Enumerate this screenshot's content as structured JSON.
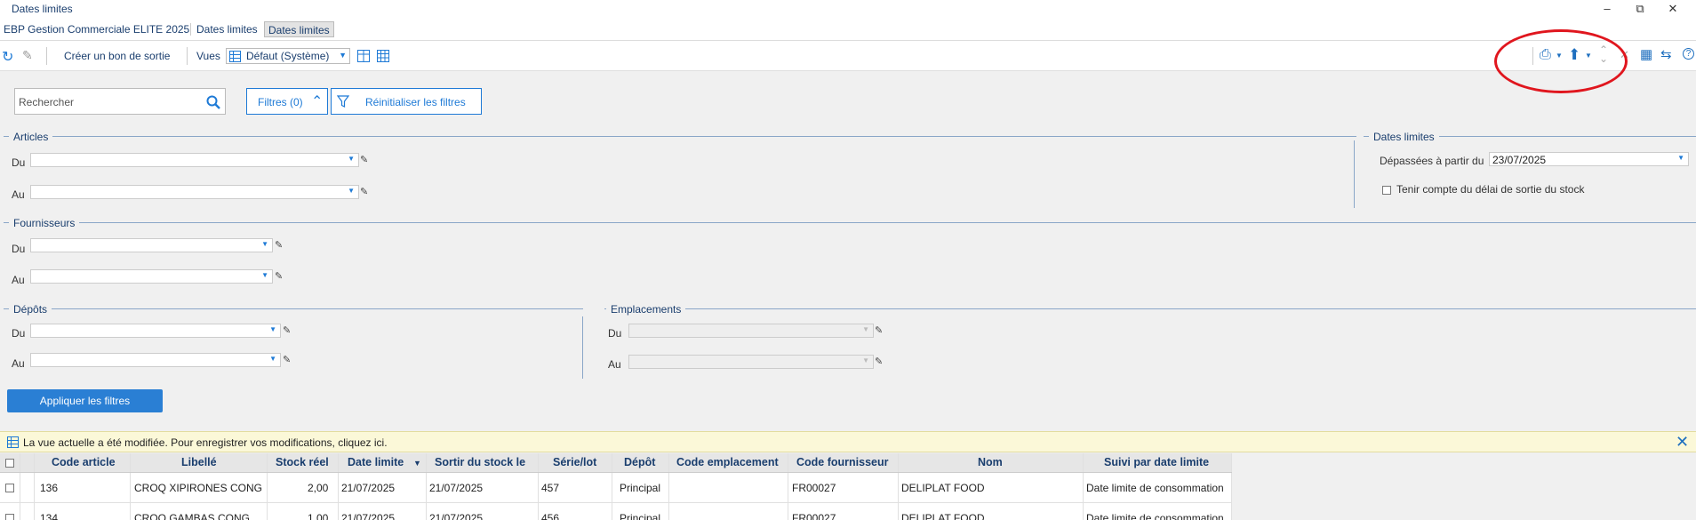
{
  "window": {
    "title": "Dates limites"
  },
  "tabs": [
    "EBP Gestion Commerciale ELITE 2025",
    "Dates limites",
    "Dates limites"
  ],
  "toolbar": {
    "create_exit_voucher": "Créer un bon de sortie",
    "views_label": "Vues",
    "views_selected": "Défaut (Système)"
  },
  "search": {
    "placeholder": "Rechercher"
  },
  "filters": {
    "filters_button": "Filtres (0)",
    "reset_button": "Réinitialiser les filtres",
    "apply_button": "Appliquer les filtres"
  },
  "sections": {
    "articles": {
      "title": "Articles",
      "from": "Du",
      "to": "Au"
    },
    "deadlines": {
      "title": "Dates limites",
      "exceeded_label": "Dépassées à partir du",
      "exceeded_value": "23/07/2025",
      "checkbox_label": "Tenir compte du délai de sortie du stock"
    },
    "suppliers": {
      "title": "Fournisseurs",
      "from": "Du",
      "to": "Au"
    },
    "depots": {
      "title": "Dépôts",
      "from": "Du",
      "to": "Au"
    },
    "locations": {
      "title": "Emplacements",
      "from": "Du",
      "to": "Au"
    }
  },
  "notice": {
    "text": "La vue actuelle a été modifiée. Pour enregistrer vos modifications, cliquez ici."
  },
  "table": {
    "columns": [
      "Code article",
      "Libellé",
      "Stock réel",
      "Date limite",
      "Sortir du stock le",
      "Série/lot",
      "Dépôt",
      "Code emplacement",
      "Code fournisseur",
      "Nom",
      "Suivi par date limite"
    ],
    "rows": [
      [
        "136",
        "CROQ XIPIRONES CONG",
        "2,00",
        "21/07/2025",
        "21/07/2025",
        "457",
        "Principal",
        "",
        "FR00027",
        "DELIPLAT FOOD",
        "Date limite de consommation"
      ],
      [
        "134",
        "CROQ GAMBAS CONG",
        "1,00",
        "21/07/2025",
        "21/07/2025",
        "456",
        "Principal",
        "",
        "FR00027",
        "DELIPLAT FOOD",
        "Date limite de consommation"
      ]
    ]
  },
  "colors": {
    "accent": "#1e7ad6",
    "title_text": "#1a3e6e",
    "annotation": "#e0161e"
  }
}
